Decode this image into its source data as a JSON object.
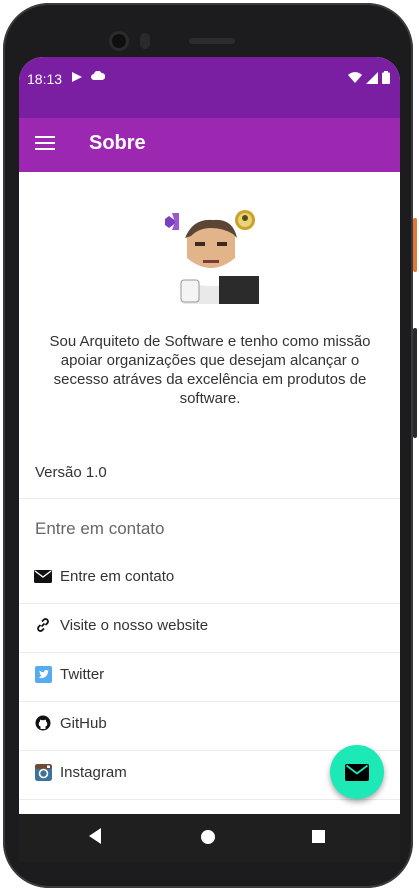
{
  "status_bar": {
    "time": "18:13",
    "left_icons": [
      "play-store-icon",
      "cloud-icon"
    ],
    "right_icons": [
      "wifi-icon",
      "signal-icon",
      "battery-icon"
    ]
  },
  "app_bar": {
    "title": "Sobre",
    "menu_icon": "hamburger-menu-icon"
  },
  "content": {
    "avatar": "profile-avatar",
    "about_text": "Sou Arquiteto de Software e tenho como missão apoiar organizações que desejam alcançar o secesso atráves da excelência em produtos de software.",
    "version": "Versão 1.0",
    "contact_section_title": "Entre em contato",
    "contact_items": [
      {
        "icon": "envelope-icon",
        "label": "Entre em contato"
      },
      {
        "icon": "link-icon",
        "label": "Visite o nosso website"
      },
      {
        "icon": "twitter-icon",
        "label": "Twitter"
      },
      {
        "icon": "github-icon",
        "label": "GitHub"
      },
      {
        "icon": "instagram-icon",
        "label": "Instagram"
      }
    ]
  },
  "fab": {
    "icon": "envelope-icon"
  },
  "colors": {
    "status_bar": "#7b1fa2",
    "app_bar": "#9c27b0",
    "fab": "#1de9b6",
    "twitter": "#55acee",
    "instagram": "#3f729b"
  }
}
